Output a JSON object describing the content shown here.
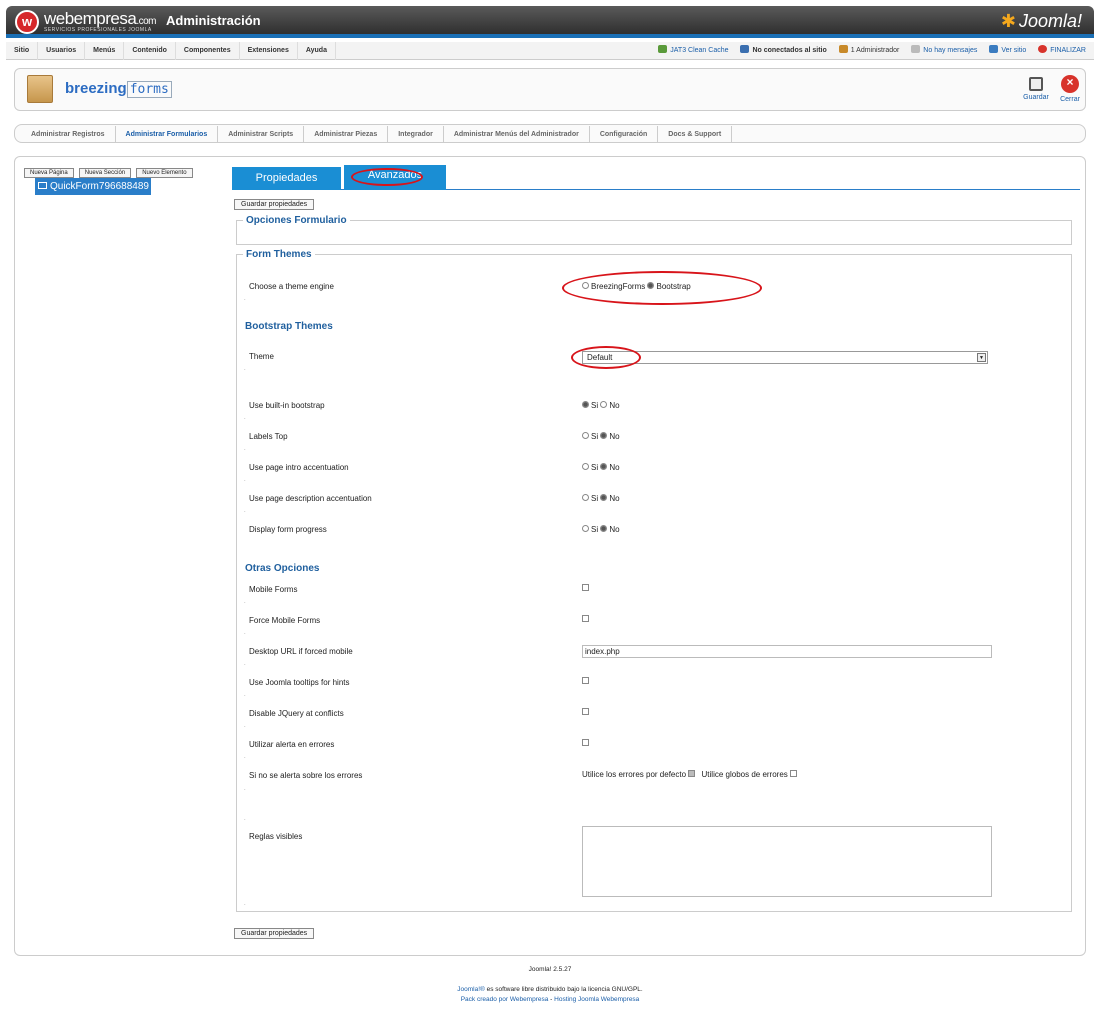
{
  "header": {
    "brand_name": "webempresa",
    "brand_tld": ".com",
    "brand_sub": "SERVICIOS PROFESIONALES JOOMLA",
    "admin_title": "Administración",
    "joomla_logo": "Joomla!"
  },
  "menubar": {
    "items": [
      "Sitio",
      "Usuarios",
      "Menús",
      "Contenido",
      "Componentes",
      "Extensiones",
      "Ayuda"
    ],
    "status": {
      "cache": "JAT3 Clean Cache",
      "visitors": "No conectados al sitio",
      "admins": "1 Administrador",
      "messages": "No hay mensajes",
      "view_site": "Ver sitio",
      "logout": "FINALIZAR"
    }
  },
  "toolbar": {
    "component_logo_a": "breezing",
    "component_logo_b": "forms",
    "save_label": "Guardar",
    "close_label": "Cerrar"
  },
  "subnav": {
    "items": [
      "Administrar Registros",
      "Administrar Formularios",
      "Administrar Scripts",
      "Administrar Piezas",
      "Integrador",
      "Administrar Menús del Administrador",
      "Configuración",
      "Docs & Support"
    ],
    "active_index": 1
  },
  "left_panel": {
    "buttons": [
      "Nueva Página",
      "Nueva Sección",
      "Nuevo Elemento"
    ],
    "tree_item": "QuickForm796688489"
  },
  "tabs": [
    "Propiedades",
    "Avanzados"
  ],
  "save_props_label": "Guardar propiedades",
  "form": {
    "opciones_legend": "Opciones Formulario",
    "themes_legend": "Form Themes",
    "theme_engine_label": "Choose a theme engine",
    "engine_opt1": "BreezingForms",
    "engine_opt2": "Bootstrap",
    "bootstrap_title": "Bootstrap Themes",
    "theme_label": "Theme",
    "theme_value": "Default",
    "yes": "Si",
    "no": "No",
    "builtin_label": "Use built-in bootstrap",
    "labels_top_label": "Labels Top",
    "intro_label": "Use page intro accentuation",
    "desc_label": "Use page description accentuation",
    "progress_label": "Display form progress",
    "otras_title": "Otras Opciones",
    "mobile_label": "Mobile Forms",
    "force_mobile_label": "Force Mobile Forms",
    "desktop_url_label": "Desktop URL if forced mobile",
    "desktop_url_value": "index.php",
    "tooltips_label": "Use Joomla tooltips for hints",
    "jquery_label": "Disable JQuery at conflicts",
    "alert_label": "Utilizar alerta en errores",
    "noalert_label": "Si no se alerta sobre los errores",
    "errors_default": "Utilice los errores por defecto",
    "errors_global": "Utilice globos de errores",
    "rules_label": "Reglas visibles"
  },
  "footer": {
    "version": "Joomla! 2.5.27",
    "license_link": "Joomla!®",
    "license_text": " es software libre distribuido bajo la licencia GNU/GPL.",
    "pack_link": "Pack creado por Webempresa",
    "separator": " - ",
    "hosting_link": "Hosting Joomla Webempresa"
  },
  "colors": {
    "accent": "#1a8ed4",
    "annotation": "#d8141a"
  }
}
